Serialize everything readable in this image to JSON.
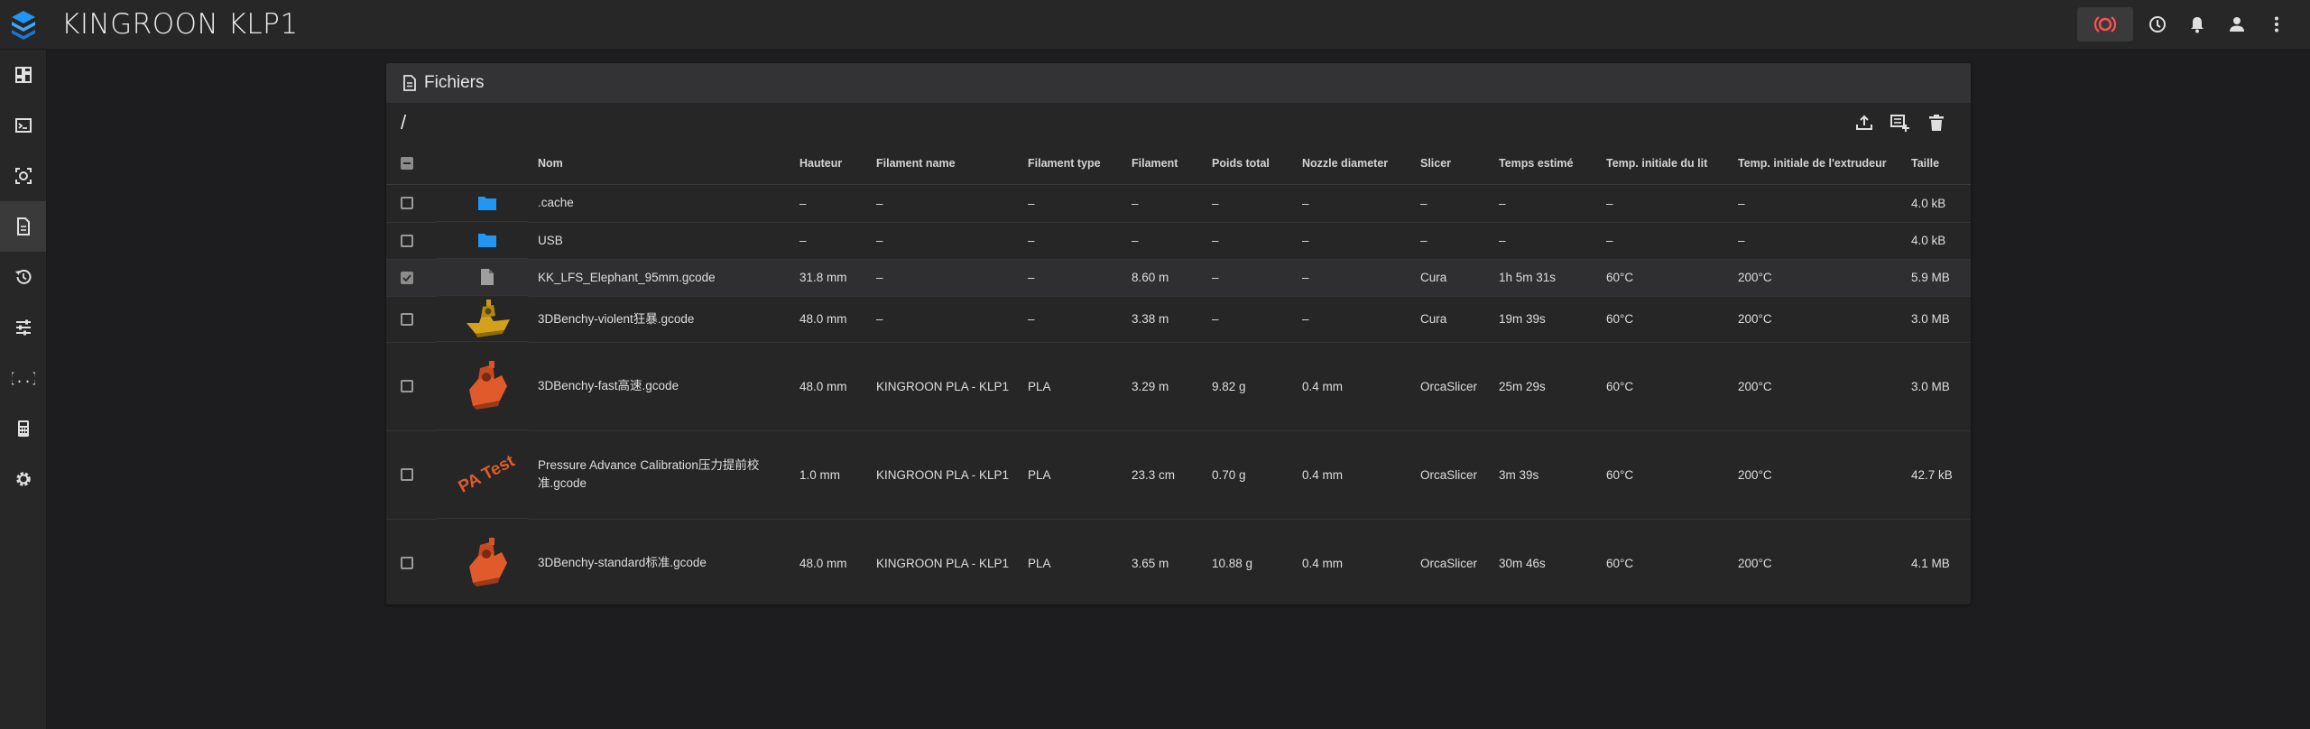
{
  "app": {
    "title": "KINGROON KLP1",
    "brand_color": "#2196f3"
  },
  "sidebar": {
    "items": [
      {
        "icon": "dashboard-icon"
      },
      {
        "icon": "console-icon"
      },
      {
        "icon": "webcam-icon"
      },
      {
        "icon": "files-icon",
        "active": true
      },
      {
        "icon": "history-icon"
      },
      {
        "icon": "tune-icon"
      },
      {
        "icon": "macros-icon"
      },
      {
        "icon": "calculator-icon"
      },
      {
        "icon": "settings-icon"
      }
    ]
  },
  "card": {
    "title": "Fichiers",
    "path": "/"
  },
  "table": {
    "headers": [
      "Nom",
      "Hauteur",
      "Filament name",
      "Filament type",
      "Filament",
      "Poids total",
      "Nozzle diameter",
      "Slicer",
      "Temps estimé",
      "Temp. initiale du lit",
      "Temp. initiale de l'extrudeur",
      "Taille"
    ],
    "rows": [
      {
        "thumb": "folder",
        "name": ".cache",
        "hauteur": "–",
        "filament_name": "–",
        "filament_type": "–",
        "filament": "–",
        "poids": "–",
        "nozzle": "–",
        "slicer": "–",
        "temps": "–",
        "temp_lit": "–",
        "temp_ext": "–",
        "taille": "4.0 kB",
        "checked": false
      },
      {
        "thumb": "folder",
        "name": "USB",
        "hauteur": "–",
        "filament_name": "–",
        "filament_type": "–",
        "filament": "–",
        "poids": "–",
        "nozzle": "–",
        "slicer": "–",
        "temps": "–",
        "temp_lit": "–",
        "temp_ext": "–",
        "taille": "4.0 kB",
        "checked": false
      },
      {
        "thumb": "file",
        "name": "KK_LFS_Elephant_95mm.gcode",
        "hauteur": "31.8 mm",
        "filament_name": "–",
        "filament_type": "–",
        "filament": "8.60 m",
        "poids": "–",
        "nozzle": "–",
        "slicer": "Cura",
        "temps": "1h 5m 31s",
        "temp_lit": "60°C",
        "temp_ext": "200°C",
        "taille": "5.9 MB",
        "checked": true
      },
      {
        "thumb": "benchy-gold",
        "name": "3DBenchy-violent狂暴.gcode",
        "hauteur": "48.0 mm",
        "filament_name": "–",
        "filament_type": "–",
        "filament": "3.38 m",
        "poids": "–",
        "nozzle": "–",
        "slicer": "Cura",
        "temps": "19m 39s",
        "temp_lit": "60°C",
        "temp_ext": "200°C",
        "taille": "3.0 MB",
        "checked": false
      },
      {
        "thumb": "benchy-orange",
        "name": "3DBenchy-fast高速.gcode",
        "hauteur": "48.0 mm",
        "filament_name": "KINGROON PLA - KLP1",
        "filament_type": "PLA",
        "filament": "3.29 m",
        "poids": "9.82 g",
        "nozzle": "0.4 mm",
        "slicer": "OrcaSlicer",
        "temps": "25m 29s",
        "temp_lit": "60°C",
        "temp_ext": "200°C",
        "taille": "3.0 MB",
        "checked": false
      },
      {
        "thumb": "pa-test",
        "thumb_label": "PA Test",
        "name": "Pressure Advance Calibration压力提前校准.gcode",
        "hauteur": "1.0 mm",
        "filament_name": "KINGROON PLA - KLP1",
        "filament_type": "PLA",
        "filament": "23.3 cm",
        "poids": "0.70 g",
        "nozzle": "0.4 mm",
        "slicer": "OrcaSlicer",
        "temps": "3m 39s",
        "temp_lit": "60°C",
        "temp_ext": "200°C",
        "taille": "42.7 kB",
        "checked": false
      },
      {
        "thumb": "benchy-orange",
        "name": "3DBenchy-standard标准.gcode",
        "hauteur": "48.0 mm",
        "filament_name": "KINGROON PLA - KLP1",
        "filament_type": "PLA",
        "filament": "3.65 m",
        "poids": "10.88 g",
        "nozzle": "0.4 mm",
        "slicer": "OrcaSlicer",
        "temps": "30m 46s",
        "temp_lit": "60°C",
        "temp_ext": "200°C",
        "taille": "4.1 MB",
        "checked": false
      }
    ]
  }
}
